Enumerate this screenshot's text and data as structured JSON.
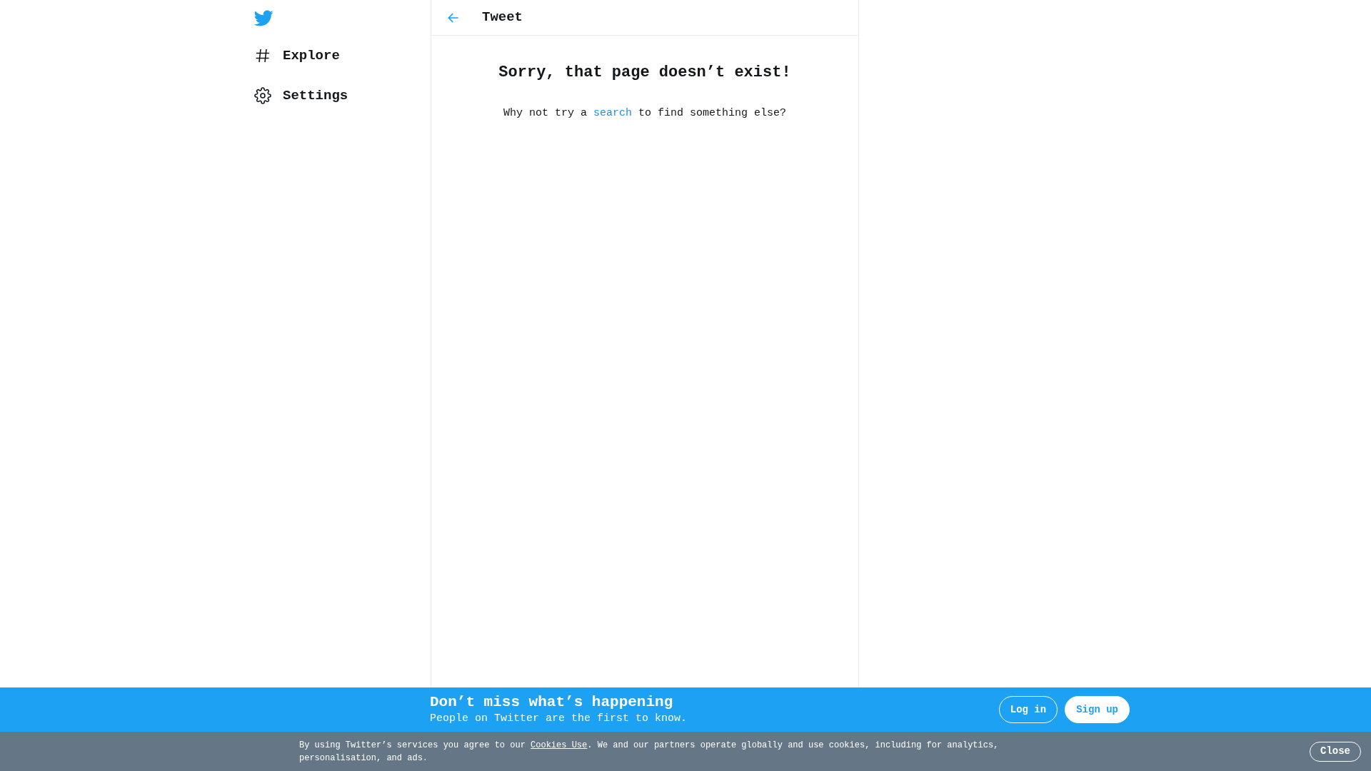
{
  "sidebar": {
    "items": [
      {
        "kind": "logo"
      },
      {
        "kind": "explore",
        "label": "Explore"
      },
      {
        "kind": "settings",
        "label": "Settings"
      }
    ]
  },
  "header": {
    "title": "Tweet"
  },
  "error": {
    "heading": "Sorry, that page doesn’t exist!",
    "text_before": "Why not try a",
    "link": "search",
    "text_after": "to find something else?"
  },
  "banner": {
    "title": "Don’t miss what’s happening",
    "subtitle": "People on Twitter are the first to know.",
    "buttons": [
      {
        "kind": "outline",
        "label": "Log in"
      },
      {
        "kind": "filled",
        "label": "Sign up"
      }
    ]
  },
  "cookie_bar": {
    "text_before": "By using Twitter’s services you agree to our",
    "link": "Cookies Use",
    "text_after": ". We and our partners operate globally and use cookies, including for analytics, personalisation, and ads.",
    "close": "Close"
  }
}
